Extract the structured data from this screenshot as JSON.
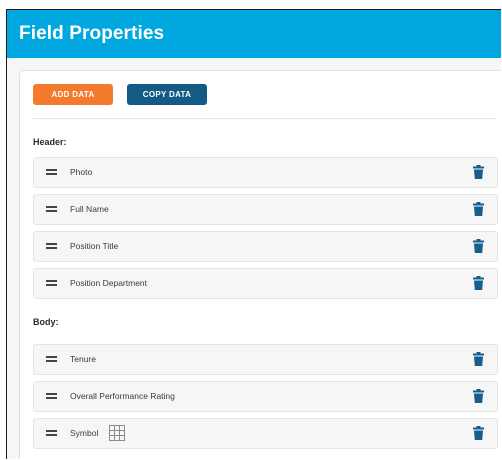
{
  "header": {
    "title": "Field Properties"
  },
  "toolbar": {
    "add_label": "ADD DATA",
    "copy_label": "COPY DATA"
  },
  "sections": [
    {
      "label": "Header:",
      "items": [
        "Photo",
        "Full Name",
        "Position Title",
        "Position Department"
      ]
    },
    {
      "label": "Body:",
      "items": [
        "Tenure",
        "Overall Performance Rating",
        "Symbol"
      ]
    }
  ],
  "icons": {
    "drag": "drag-handle-icon",
    "delete": "trash-icon",
    "symbol": "grid-icon"
  },
  "colors": {
    "header": "#00a8df",
    "add_button": "#f47a2e",
    "copy_button": "#135a85",
    "trash": "#165f8c"
  }
}
